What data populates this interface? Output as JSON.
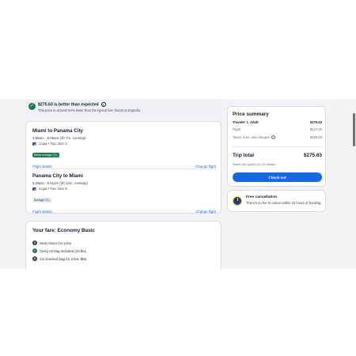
{
  "savings": {
    "headline": "$275.63 is better than expected",
    "subtext": "This price is at least 54% lower than the typical fare found on Expedia"
  },
  "flights": [
    {
      "route": "Miami to Panama City",
      "times": "4:59am - 8:06am (3h 7m, nonstop)",
      "carrier": "Copa • Tue, Dec 2",
      "tag": "Below average CO₂",
      "details_link": "Flight details",
      "change_link": "Change flight"
    },
    {
      "route": "Panama City to Miami",
      "times": "3:39pm - 6:51pm (3h 12m, nonstop)",
      "carrier": "Copa • Tue, Dec 9",
      "tag": "Average CO₂",
      "details_link": "Flight details",
      "change_link": "Change flight"
    }
  ],
  "fare": {
    "title": "Your fare: Economy Basic",
    "items": [
      "Seat choice for a fee",
      "Carry-on bag included (22 lbs)",
      "1st checked bag for a fee: $55"
    ]
  },
  "summary": {
    "title": "Price summary",
    "traveler_label": "Traveler 1: Adult",
    "traveler_value": "$275.63",
    "flight_label": "Flight",
    "flight_value": "$147.00",
    "taxes_label": "Taxes, fees, and charges",
    "taxes_value": "$128.63",
    "total_label": "Trip total",
    "total_value": "$275.63",
    "note": "Rates are quoted in US dollars",
    "checkout_label": "Check out"
  },
  "cancellation": {
    "title": "Free cancellation",
    "description": "There's no fee to cancel within 24 hours of booking."
  },
  "colors": {
    "accent": "#1668e3",
    "good": "#227950"
  }
}
